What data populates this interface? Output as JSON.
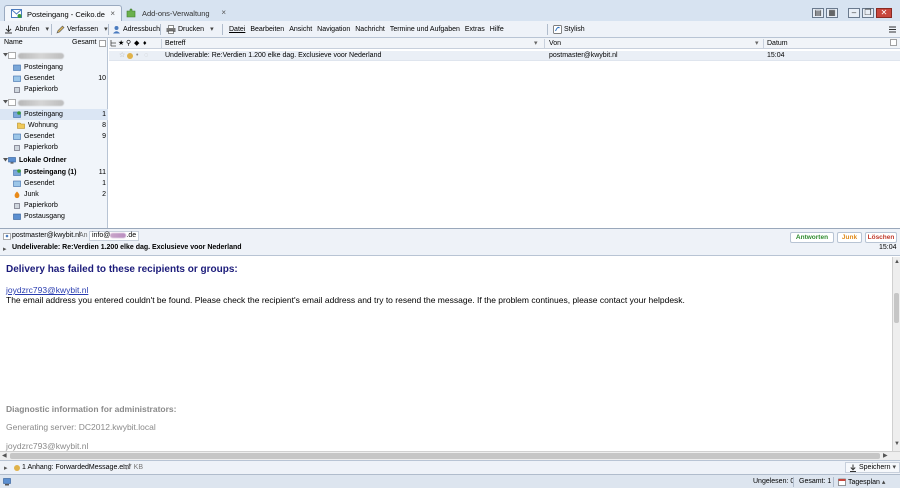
{
  "window": {
    "tabs": [
      {
        "label": "Posteingang - Ceiko.de",
        "active": true
      },
      {
        "label": "Add-ons-Verwaltung",
        "active": false
      }
    ],
    "tab_close": "×"
  },
  "toolbar": {
    "fetch": "Abrufen",
    "compose": "Verfassen",
    "addressbook": "Adressbuch",
    "print": "Drucken",
    "menus": [
      "Datei",
      "Bearbeiten",
      "Ansicht",
      "Navigation",
      "Nachricht",
      "Termine und Aufgaben",
      "Extras",
      "Hilfe"
    ],
    "stylish": "Stylish"
  },
  "folder_pane": {
    "header_name": "Name",
    "header_total": "Gesamt",
    "account2_folders": [
      {
        "label": "Posteingang",
        "count": ""
      },
      {
        "label": "Gesendet",
        "count": "10"
      },
      {
        "label": "Papierkorb",
        "count": ""
      }
    ],
    "account3_folders": [
      {
        "label": "Posteingang",
        "count": "1"
      },
      {
        "label": "Wohnung",
        "count": "8"
      },
      {
        "label": "Gesendet",
        "count": "9"
      },
      {
        "label": "Papierkorb",
        "count": ""
      }
    ],
    "local_title": "Lokale Ordner",
    "local_folders": [
      {
        "label": "Posteingang (1)",
        "count": "11",
        "bold": true
      },
      {
        "label": "Gesendet",
        "count": "1"
      },
      {
        "label": "Junk",
        "count": "2"
      },
      {
        "label": "Papierkorb",
        "count": ""
      },
      {
        "label": "Postausgang",
        "count": ""
      }
    ]
  },
  "message_list": {
    "columns": {
      "subject": "Betreff",
      "from": "Von",
      "date": "Datum"
    },
    "rows": [
      {
        "subject": "Undeliverable: Re:Verdien 1.200 elke dag. Exclusieve voor Nederland",
        "from": "postmaster@kwybit.nl",
        "date": "15:04"
      }
    ]
  },
  "message_header": {
    "from": "postmaster@kwybit.nl",
    "to_label": "An",
    "to_prefix": "info@",
    "to_suffix": ".de",
    "subject": "Undeliverable: Re:Verdien 1.200 elke dag. Exclusieve voor Nederland",
    "time": "15:04",
    "buttons": {
      "reply": "Antworten",
      "junk": "Junk",
      "delete": "Löschen"
    }
  },
  "body": {
    "heading": "Delivery has failed to these recipients or groups:",
    "recipient": "joydzrc793@kwybit.nl",
    "message": "The email address you entered couldn't be found. Please check the recipient's email address and try to resend the message. If the problem continues, please contact your helpdesk.",
    "diag_heading": "Diagnostic information for administrators:",
    "server": "Generating server: DC2012.kwybit.local",
    "recipient2": "joydzrc793@kwybit.nl"
  },
  "attachment": {
    "label": "1 Anhang: ForwardedMessage.eml",
    "size": "1,7 KB",
    "save": "Speichern"
  },
  "status": {
    "unread": "Ungelesen: 0",
    "total": "Gesamt: 1",
    "agenda": "Tagesplan"
  },
  "colors": {
    "titlebar": "#d7e3f1",
    "toolbar": "#eef2f8",
    "selection": "#dbe6f4",
    "heading_blue": "#1b1b7a",
    "link_blue": "#2a3db0",
    "gray_text": "#8a8a8a",
    "reply_green": "#2e8b2e",
    "junk_orange": "#e08a1a",
    "delete_red": "#c0392b"
  }
}
